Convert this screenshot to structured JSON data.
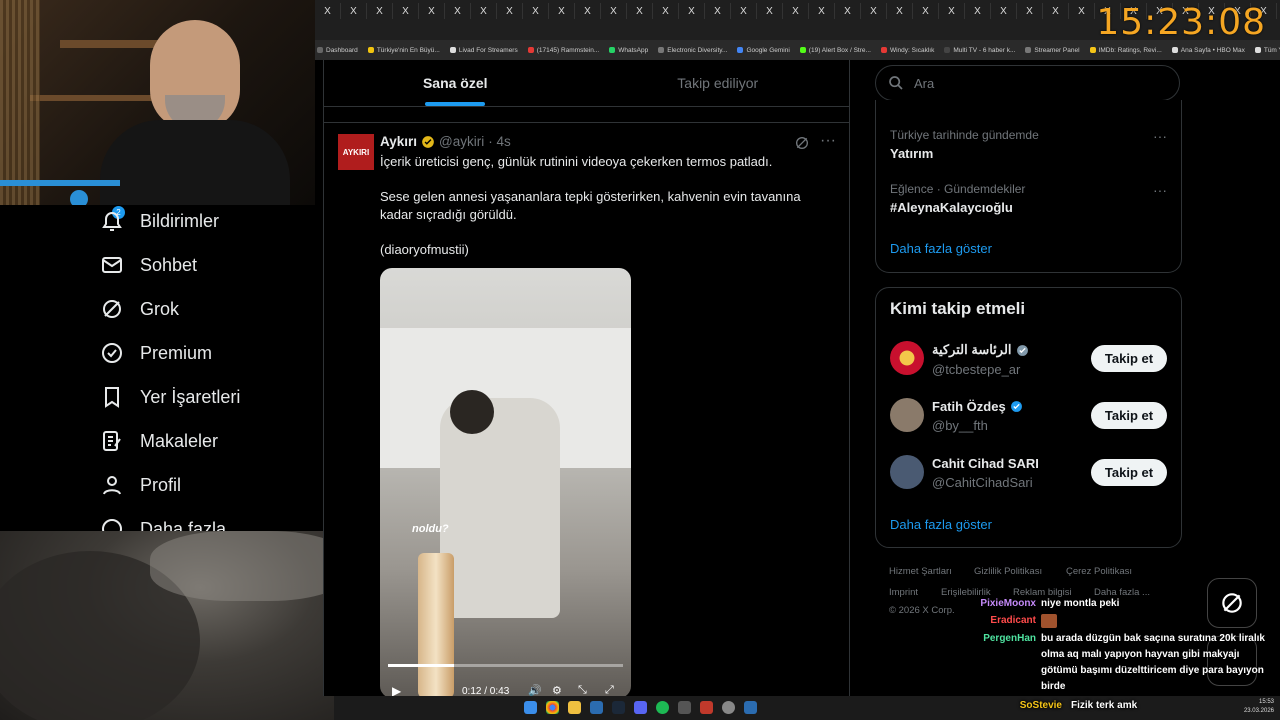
{
  "overlay": {
    "clock": "15:23:08"
  },
  "browser": {
    "bookmarks": [
      {
        "label": "Dashboard",
        "color": "#666"
      },
      {
        "label": "Türkiye'nin En Büyü...",
        "color": "#f1c40f"
      },
      {
        "label": "Livad For Streamers",
        "color": "#ddd"
      },
      {
        "label": "(17145) Rammstein...",
        "color": "#e53935"
      },
      {
        "label": "WhatsApp",
        "color": "#25d366"
      },
      {
        "label": "Electronic Diversity...",
        "color": "#777"
      },
      {
        "label": "Google Gemini",
        "color": "#4285f4"
      },
      {
        "label": "(19) Alert Box / Stre...",
        "color": "#53fc18"
      },
      {
        "label": "Windy: Sıcaklık",
        "color": "#e53935"
      },
      {
        "label": "Multi TV - 6 haber k...",
        "color": "#444"
      },
      {
        "label": "Streamer Panel",
        "color": "#777"
      },
      {
        "label": "IMDb: Ratings, Revi...",
        "color": "#f5c518"
      },
      {
        "label": "Ana Sayfa • HBO Max",
        "color": "#ddd"
      },
      {
        "label": "Tüm Yer İşaretleri",
        "color": "#ddd"
      }
    ]
  },
  "sidebar": {
    "notif_badge": "2",
    "items": [
      {
        "label": "Bildirimler",
        "icon": "bell-icon"
      },
      {
        "label": "Sohbet",
        "icon": "mail-icon"
      },
      {
        "label": "Grok",
        "icon": "grok-icon"
      },
      {
        "label": "Premium",
        "icon": "premium-icon"
      },
      {
        "label": "Yer İşaretleri",
        "icon": "bookmark-icon"
      },
      {
        "label": "Makaleler",
        "icon": "article-icon"
      },
      {
        "label": "Profil",
        "icon": "profile-icon"
      },
      {
        "label": "Daha fazla",
        "icon": "more-icon"
      }
    ]
  },
  "timeline": {
    "tabs": [
      {
        "label": "Sana özel",
        "active": true
      },
      {
        "label": "Takip ediliyor",
        "active": false
      }
    ],
    "tweet": {
      "avatar_text": "AYKIRI",
      "name": "Aykırı",
      "handle": "@aykiri",
      "time": "· 4s",
      "p1": "İçerik üreticisi genç, günlük rutinini videoya çekerken termos patladı.",
      "p2": "Sese gelen annesi yaşananlara tepki gösterirken, kahvenin evin tavanına kadar sıçradığı görüldü.",
      "p3": "(diaoryofmustii)",
      "video_caption": "noldu?",
      "video_time": "0:12 / 0:43",
      "video_progress": 0.28
    }
  },
  "right": {
    "search_placeholder": "Ara",
    "trends": [
      {
        "sub": "Türkiye tarihinde gündemde",
        "main": "Yatırım"
      },
      {
        "sub": "Eğlence · Gündemdekiler",
        "main": "#AleynaKalaycıoğlu"
      }
    ],
    "show_more": "Daha fazla göster",
    "who_title": "Kimi takip etmeli",
    "who": [
      {
        "name": "الرئاسة التركية",
        "handle": "@tcbestepe_ar",
        "verified": "gray",
        "button": "Takip et"
      },
      {
        "name": "Fatih Özdeş",
        "handle": "@by__fth",
        "verified": "blue",
        "button": "Takip et"
      },
      {
        "name": "Cahit Cihad SARI",
        "handle": "@CahitCihadSari",
        "verified": "",
        "button": "Takip et"
      }
    ],
    "who_show_more": "Daha fazla göster",
    "footer": [
      "Hizmet Şartları",
      "Gizlilik Politikası",
      "Çerez Politikası",
      "Imprint",
      "Erişilebilirlik",
      "Reklam bilgisi",
      "Daha fazla ...",
      "© 2026 X Corp."
    ]
  },
  "chat": [
    {
      "user": "PixieMoonx",
      "color": "#c58af9",
      "msg": "niye montla peki"
    },
    {
      "user": "Eradicant",
      "color": "#ff4b4b",
      "msg": ""
    },
    {
      "user": "PergenHan",
      "color": "#4fe3a0",
      "msg": "bu arada düzgün bak saçına suratına 20k liralık olma aq malı yapıyon hayvan gibi makyajı götümü başımı düzelttiricem diye para bayıyon birde"
    },
    {
      "user": "SoStevie",
      "color": "#f5c518",
      "msg": "Fizik terk amk"
    }
  ],
  "taskbar": {
    "time": "15:53",
    "date": "23.03.2026"
  }
}
